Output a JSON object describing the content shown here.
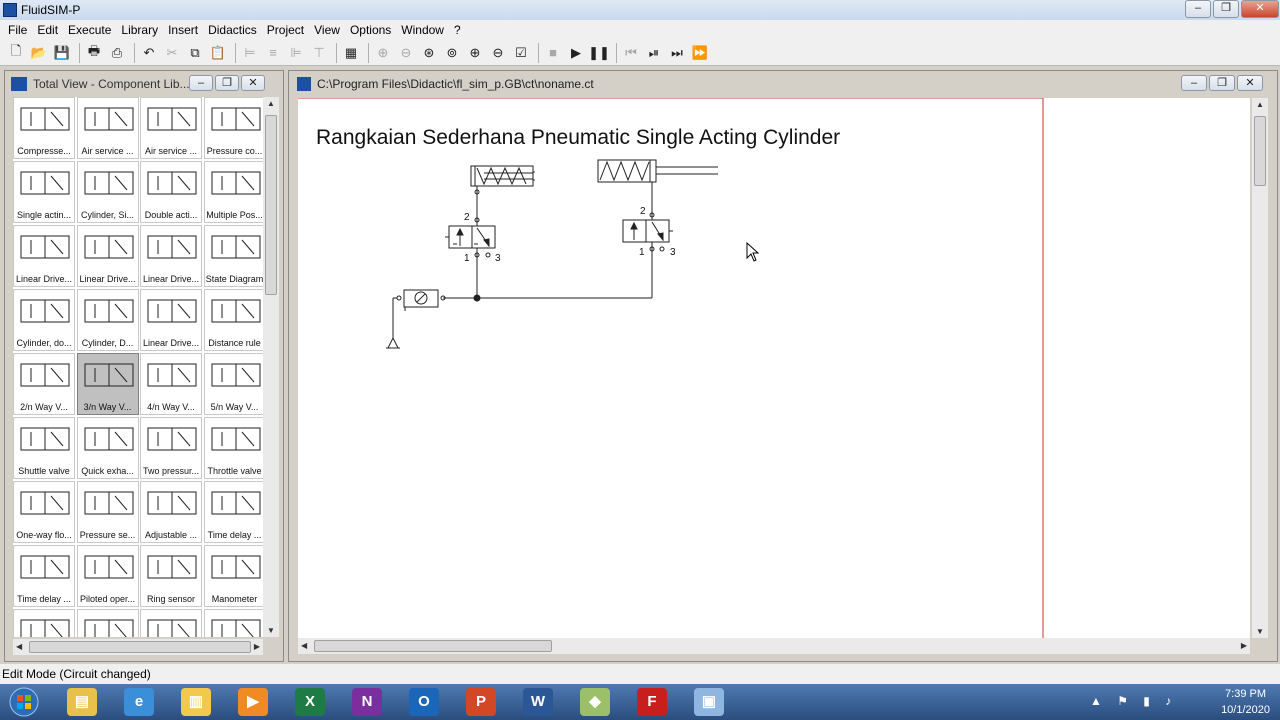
{
  "app": {
    "title": "FluidSIM-P"
  },
  "menu": [
    "File",
    "Edit",
    "Execute",
    "Library",
    "Insert",
    "Didactics",
    "Project",
    "View",
    "Options",
    "Window",
    "?"
  ],
  "library": {
    "title": "Total View - Component Lib...",
    "items": [
      {
        "label": "Compresse...",
        "icon": "compressor"
      },
      {
        "label": "Air service ...",
        "icon": "air-service-unit"
      },
      {
        "label": "Air service ...",
        "icon": "air-service-unit-detailed"
      },
      {
        "label": "Pressure co...",
        "icon": "pressure-control"
      },
      {
        "label": "Single actin...",
        "icon": "single-acting-cylinder"
      },
      {
        "label": "Cylinder, Si...",
        "icon": "cylinder-single"
      },
      {
        "label": "Double acti...",
        "icon": "double-acting-cylinder"
      },
      {
        "label": "Multiple Pos...",
        "icon": "multiple-position-cylinder"
      },
      {
        "label": "Linear Drive...",
        "icon": "linear-drive"
      },
      {
        "label": "Linear Drive...",
        "icon": "linear-drive-2"
      },
      {
        "label": "Linear Drive...",
        "icon": "linear-drive-3"
      },
      {
        "label": "State Diagram",
        "icon": "state-diagram"
      },
      {
        "label": "Cylinder, do...",
        "icon": "cylinder-double"
      },
      {
        "label": "Cylinder, D...",
        "icon": "cylinder-d"
      },
      {
        "label": "Linear Drive...",
        "icon": "linear-drive-4"
      },
      {
        "label": "Distance rule",
        "icon": "distance-rule"
      },
      {
        "label": "2/n Way V...",
        "icon": "valve-2n"
      },
      {
        "label": "3/n Way V...",
        "icon": "valve-3n",
        "selected": true
      },
      {
        "label": "4/n Way V...",
        "icon": "valve-4n"
      },
      {
        "label": "5/n Way V...",
        "icon": "valve-5n"
      },
      {
        "label": "Shuttle valve",
        "icon": "shuttle-valve"
      },
      {
        "label": "Quick exha...",
        "icon": "quick-exhaust-valve"
      },
      {
        "label": "Two pressur...",
        "icon": "two-pressure-valve"
      },
      {
        "label": "Throttle valve",
        "icon": "throttle-valve"
      },
      {
        "label": "One-way flo...",
        "icon": "one-way-flow-valve"
      },
      {
        "label": "Pressure se...",
        "icon": "pressure-sequence-valve"
      },
      {
        "label": "Adjustable ...",
        "icon": "adjustable-valve"
      },
      {
        "label": "Time delay ...",
        "icon": "time-delay-valve"
      },
      {
        "label": "Time delay ...",
        "icon": "time-delay-valve-2"
      },
      {
        "label": "Piloted oper...",
        "icon": "piloted-operated-valve"
      },
      {
        "label": "Ring sensor",
        "icon": "ring-sensor"
      },
      {
        "label": "Manometer",
        "icon": "manometer"
      },
      {
        "label": "",
        "icon": "partial-1"
      },
      {
        "label": "",
        "icon": "partial-2"
      },
      {
        "label": "",
        "icon": "partial-3"
      },
      {
        "label": "",
        "icon": "partial-4"
      }
    ]
  },
  "circuit": {
    "path": "C:\\Program Files\\Didactic\\fl_sim_p.GB\\ct\\noname.ct",
    "heading": "Rangkaian Sederhana Pneumatic Single Acting Cylinder",
    "port_labels": {
      "v1_2": "2",
      "v1_1": "1",
      "v1_3": "3",
      "v2_2": "2",
      "v2_1": "1",
      "v2_3": "3"
    }
  },
  "status": {
    "text": "Edit Mode (Circuit changed)"
  },
  "taskbar": {
    "apps": [
      {
        "name": "windows-explorer",
        "glyph": "▤",
        "color": "#e8c04a"
      },
      {
        "name": "ie",
        "glyph": "e",
        "color": "#3b8ed8"
      },
      {
        "name": "file-explorer",
        "glyph": "▥",
        "color": "#f2c94c"
      },
      {
        "name": "media-player",
        "glyph": "▶",
        "color": "#f08a24"
      },
      {
        "name": "excel",
        "glyph": "X",
        "color": "#1e7b45"
      },
      {
        "name": "onenote",
        "glyph": "N",
        "color": "#7b2f9e"
      },
      {
        "name": "outlook",
        "glyph": "O",
        "color": "#1a66b8"
      },
      {
        "name": "powerpoint",
        "glyph": "P",
        "color": "#d24726"
      },
      {
        "name": "word",
        "glyph": "W",
        "color": "#2b5797"
      },
      {
        "name": "maps",
        "glyph": "◆",
        "color": "#9cc06a"
      },
      {
        "name": "fluidsim",
        "glyph": "F",
        "color": "#c81e1e"
      },
      {
        "name": "remote-desktop",
        "glyph": "▣",
        "color": "#8fb6e0"
      }
    ],
    "time": "7:39 PM",
    "date": "10/1/2020"
  }
}
